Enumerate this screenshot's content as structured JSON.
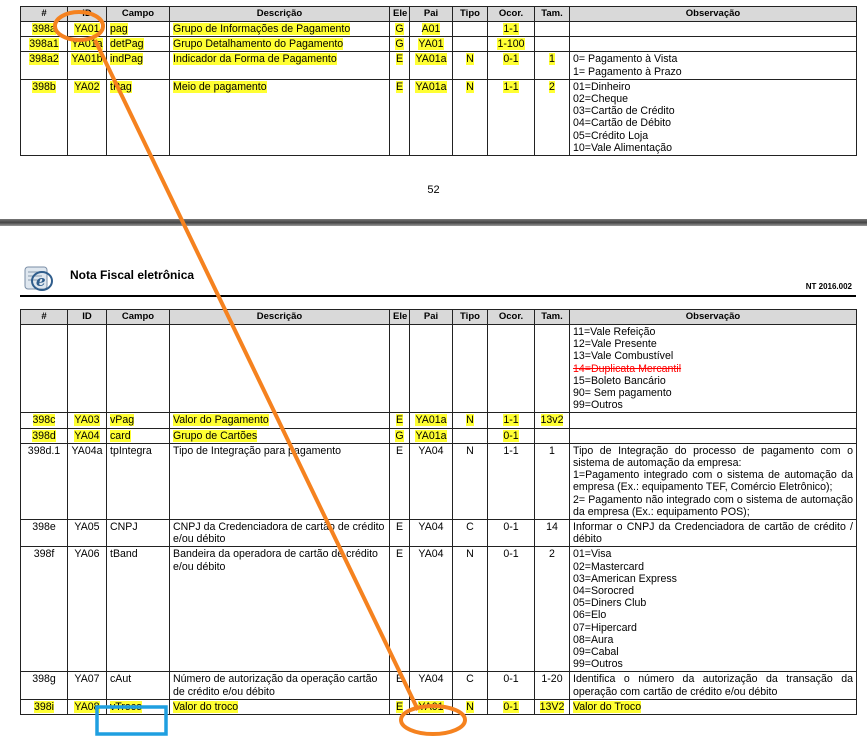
{
  "columns": [
    "#",
    "ID",
    "Campo",
    "Descrição",
    "Ele",
    "Pai",
    "Tipo",
    "Ocor.",
    "Tam.",
    "Observação"
  ],
  "page_number": "52",
  "header": {
    "title": "Nota Fiscal eletrônica",
    "version": "NT 2016.002"
  },
  "table1": [
    {
      "num": "398a",
      "id": "YA01",
      "campo": "pag",
      "desc": "Grupo de Informações de Pagamento",
      "ele": "G",
      "pai": "A01",
      "tipo": "",
      "ocor": "1-1",
      "tam": "",
      "obs": [],
      "hl": true
    },
    {
      "num": "398a1",
      "id": "YA01a",
      "campo": "detPag",
      "desc": "Grupo Detalhamento do Pagamento",
      "ele": "G",
      "pai": "YA01",
      "tipo": "",
      "ocor": "1-100",
      "tam": "",
      "obs": [],
      "hl": true
    },
    {
      "num": "398a2",
      "id": "YA01b",
      "campo": "indPag",
      "desc": "Indicador da Forma de Pagamento",
      "ele": "E",
      "pai": "YA01a",
      "tipo": "N",
      "ocor": "0-1",
      "tam": "1",
      "obs": [
        "0= Pagamento à Vista",
        "1= Pagamento à Prazo"
      ],
      "hl": true
    },
    {
      "num": "398b",
      "id": "YA02",
      "campo": "tPag",
      "desc": "Meio de pagamento",
      "ele": "E",
      "pai": "YA01a",
      "tipo": "N",
      "ocor": "1-1",
      "tam": "2",
      "obs": [
        "01=Dinheiro",
        "02=Cheque",
        "03=Cartão de Crédito",
        "04=Cartão de Débito",
        "05=Crédito Loja",
        "10=Vale Alimentação"
      ],
      "hl": true
    }
  ],
  "table2_cont": [
    "11=Vale Refeição",
    "12=Vale Presente",
    "13=Vale Combustível",
    "14=Duplicata Mercantil",
    "15=Boleto Bancário",
    "90= Sem pagamento",
    "99=Outros"
  ],
  "table2": [
    {
      "num": "398c",
      "id": "YA03",
      "campo": "vPag",
      "desc": "Valor do Pagamento",
      "ele": "E",
      "pai": "YA01a",
      "tipo": "N",
      "ocor": "1-1",
      "tam": "13v2",
      "obs": "",
      "hl": true
    },
    {
      "num": "398d",
      "id": "YA04",
      "campo": "card",
      "desc": "Grupo de Cartões",
      "ele": "G",
      "pai": "YA01a",
      "tipo": "",
      "ocor": "0-1",
      "tam": "",
      "obs": "",
      "hl": true
    },
    {
      "num": "398d.1",
      "id": "YA04a",
      "campo": "tpIntegra",
      "desc": "Tipo de Integração para pagamento",
      "ele": "E",
      "pai": "YA04",
      "tipo": "N",
      "ocor": "1-1",
      "tam": "1",
      "obs": [
        "Tipo de Integração do processo de pagamento com o sistema de automação da empresa:",
        "1=Pagamento integrado com o sistema de automação da empresa (Ex.: equipamento TEF, Comércio Eletrônico);",
        "2= Pagamento não integrado com o sistema de automação da empresa (Ex.: equipamento POS);"
      ],
      "hl": false
    },
    {
      "num": "398e",
      "id": "YA05",
      "campo": "CNPJ",
      "desc": "CNPJ da Credenciadora de cartão de crédito e/ou débito",
      "ele": "E",
      "pai": "YA04",
      "tipo": "C",
      "ocor": "0-1",
      "tam": "14",
      "obs": "Informar o CNPJ da Credenciadora de cartão de crédito / débito",
      "hl": false
    },
    {
      "num": "398f",
      "id": "YA06",
      "campo": "tBand",
      "desc": "Bandeira da operadora de cartão de crédito e/ou débito",
      "ele": "E",
      "pai": "YA04",
      "tipo": "N",
      "ocor": "0-1",
      "tam": "2",
      "obs_plain": [
        "01=Visa",
        "02=Mastercard",
        "03=American Express",
        "04=Sorocred"
      ],
      "obs_hl": [
        "05=Diners Club",
        "06=Elo",
        "07=Hipercard",
        "08=Aura",
        "09=Cabal"
      ],
      "obs_tail": [
        "99=Outros"
      ],
      "hl": false
    },
    {
      "num": "398g",
      "id": "YA07",
      "campo": "cAut",
      "desc": "Número de autorização da operação cartão de crédito e/ou débito",
      "ele": "E",
      "pai": "YA04",
      "tipo": "C",
      "ocor": "0-1",
      "tam": "1-20",
      "obs": "Identifica o número da autorização da transação da operação com cartão de crédito e/ou débito",
      "hl": false
    },
    {
      "num": "398i",
      "id": "YA08",
      "campo": "vTroco",
      "desc": "Valor do troco",
      "ele": "E",
      "pai": "YA01",
      "tipo": "N",
      "ocor": "0-1",
      "tam": "13V2",
      "obs": "Valor do Troco",
      "hl": true
    }
  ],
  "colors": {
    "highlight": "#ffff33",
    "annotation_orange": "#f5821f",
    "annotation_blue": "#1f9fe0",
    "header_gray": "#d9d9d9",
    "strike_red": "#ff0000"
  }
}
